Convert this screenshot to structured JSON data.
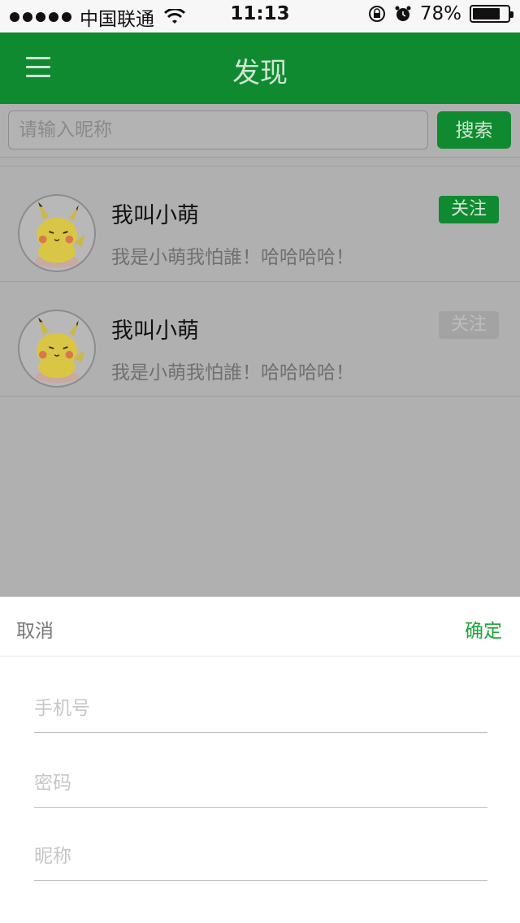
{
  "status_bar": {
    "carrier": "中国联通",
    "time": "11:13",
    "battery_percent": "78%",
    "battery_level": 0.78,
    "signal_dots": 5
  },
  "nav": {
    "title": "发现",
    "menu_icon": "hamburger-menu-icon"
  },
  "search": {
    "placeholder": "请输入昵称",
    "button_label": "搜索"
  },
  "users": [
    {
      "name": "我叫小萌",
      "bio": "我是小萌我怕誰！哈哈哈哈！",
      "follow_label": "关注",
      "follow_state": "active"
    },
    {
      "name": "我叫小萌",
      "bio": "我是小萌我怕誰！哈哈哈哈！",
      "follow_label": "关注",
      "follow_state": "disabled"
    }
  ],
  "sheet": {
    "cancel_label": "取消",
    "confirm_label": "确定",
    "fields": [
      {
        "placeholder": "手机号"
      },
      {
        "placeholder": "密码"
      },
      {
        "placeholder": "昵称"
      }
    ]
  },
  "colors": {
    "brand_green": "#108a30",
    "confirm_green": "#1ea33b",
    "overlay_gray": "#b0b0b0"
  }
}
